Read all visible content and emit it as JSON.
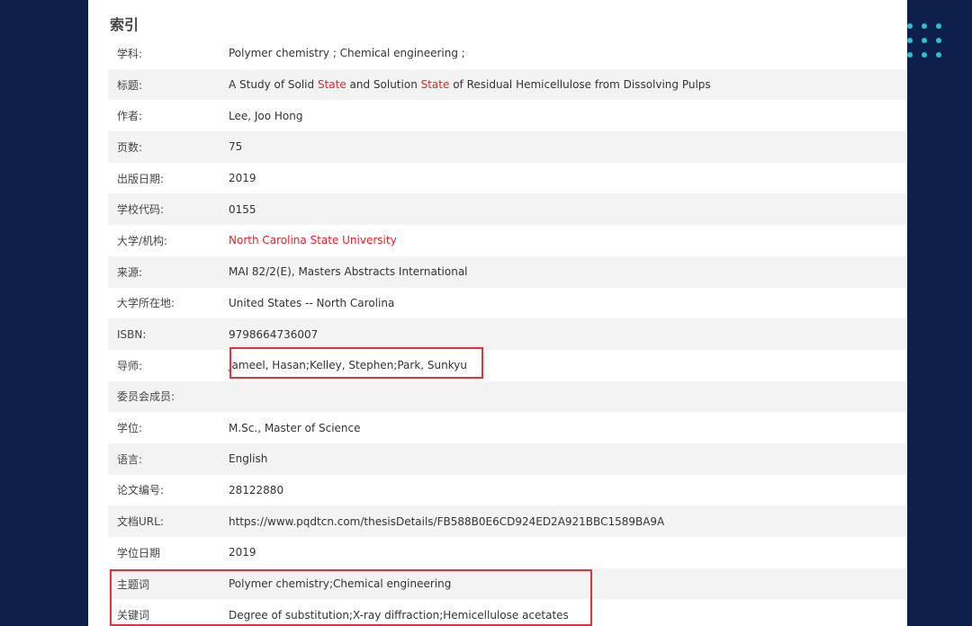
{
  "section_title": "索引",
  "rows": [
    {
      "label": "学科:",
      "value": "Polymer chemistry ; Chemical engineering ;"
    },
    {
      "label": "标题:",
      "title_parts": [
        "A Study of Solid ",
        "State",
        " and Solution ",
        "State",
        " of Residual Hemicellulose from Dissolving Pulps"
      ]
    },
    {
      "label": "作者:",
      "value": "Lee, Joo Hong"
    },
    {
      "label": "页数:",
      "value": "75"
    },
    {
      "label": "出版日期:",
      "value": "2019"
    },
    {
      "label": "学校代码:",
      "value": "0155"
    },
    {
      "label": "大学/机构:",
      "value": "North Carolina State University"
    },
    {
      "label": "来源:",
      "value": "MAI 82/2(E), Masters Abstracts International"
    },
    {
      "label": "大学所在地:",
      "value": "United States -- North Carolina"
    },
    {
      "label": "ISBN:",
      "value": "9798664736007"
    },
    {
      "label": "导师:",
      "value": "Jameel, Hasan;Kelley, Stephen;Park, Sunkyu"
    },
    {
      "label": "委员会成员:",
      "value": ""
    },
    {
      "label": "学位:",
      "value": "M.Sc., Master of Science"
    },
    {
      "label": "语言:",
      "value": "English"
    },
    {
      "label": "论文编号:",
      "value": "28122880"
    },
    {
      "label": "文档URL:",
      "value": "https://www.pqdtcn.com/thesisDetails/FB588B0E6CD924ED2A921BBC1589BA9A"
    },
    {
      "label": "学位日期",
      "value": "2019"
    },
    {
      "label": "主题词",
      "value": "Polymer chemistry;Chemical engineering"
    },
    {
      "label": "关键词",
      "value": "Degree of substitution;X-ray diffraction;Hemicellulose acetates"
    }
  ],
  "colors": {
    "background": "#0b1f4a",
    "highlight": "#e8202a",
    "box": "#e0333b",
    "dots": "#27c3d4"
  }
}
